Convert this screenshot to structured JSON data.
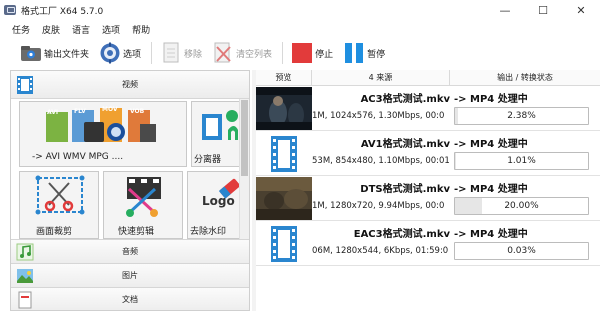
{
  "window": {
    "title": "格式工厂 X64 5.7.0",
    "minimize": "—",
    "maximize": "☐",
    "close": "✕"
  },
  "menu": [
    "任务",
    "皮肤",
    "语言",
    "选项",
    "帮助"
  ],
  "toolbar": {
    "output_folder": "输出文件夹",
    "options": "选项",
    "remove": "移除",
    "clear_list": "清空列表",
    "stop": "停止",
    "pause": "暂停"
  },
  "left_panel": {
    "video_category": "视频",
    "tiles": {
      "all_to_label": "-> AVI WMV MPG ....",
      "splitter_label": "分离器",
      "crop_label": "画面裁剪",
      "quick_cut_label": "快速剪辑",
      "remove_watermark_label": "去除水印",
      "format_badges": [
        "AVI",
        "FLV",
        "MOV",
        "VOB"
      ],
      "logo_text": "Logo"
    },
    "categories": [
      "音频",
      "图片",
      "文档"
    ]
  },
  "task_table": {
    "headers": {
      "preview": "预览",
      "source": "4 来源",
      "output": "输出 / 转换状态"
    },
    "rows": [
      {
        "name": "AC3格式测试.mkv",
        "info": "1M, 1024x576, 1.30Mbps, 00:0",
        "status": "-> MP4 处理中",
        "progress_text": "2.38%",
        "progress": 0.0238,
        "thumb": "dark-movie"
      },
      {
        "name": "AV1格式测试.mkv",
        "info": "53M, 854x480, 1.10Mbps, 00:01",
        "status": "-> MP4 处理中",
        "progress_text": "1.01%",
        "progress": 0.0101,
        "thumb": "film-icon"
      },
      {
        "name": "DTS格式测试.mkv",
        "info": "1M, 1280x720, 9.94Mbps, 00:0",
        "status": "-> MP4 处理中",
        "progress_text": "20.00%",
        "progress": 0.2,
        "thumb": "brown-scene"
      },
      {
        "name": "EAC3格式测试.mkv",
        "info": "06M, 1280x544, 6Kbps, 01:59:0",
        "status": "-> MP4 处理中",
        "progress_text": "0.03%",
        "progress": 0.0003,
        "thumb": "film-icon"
      }
    ]
  },
  "colors": {
    "stop_red": "#e23b3b",
    "pause_blue": "#1f8fe0",
    "film_blue": "#2a86cf"
  }
}
